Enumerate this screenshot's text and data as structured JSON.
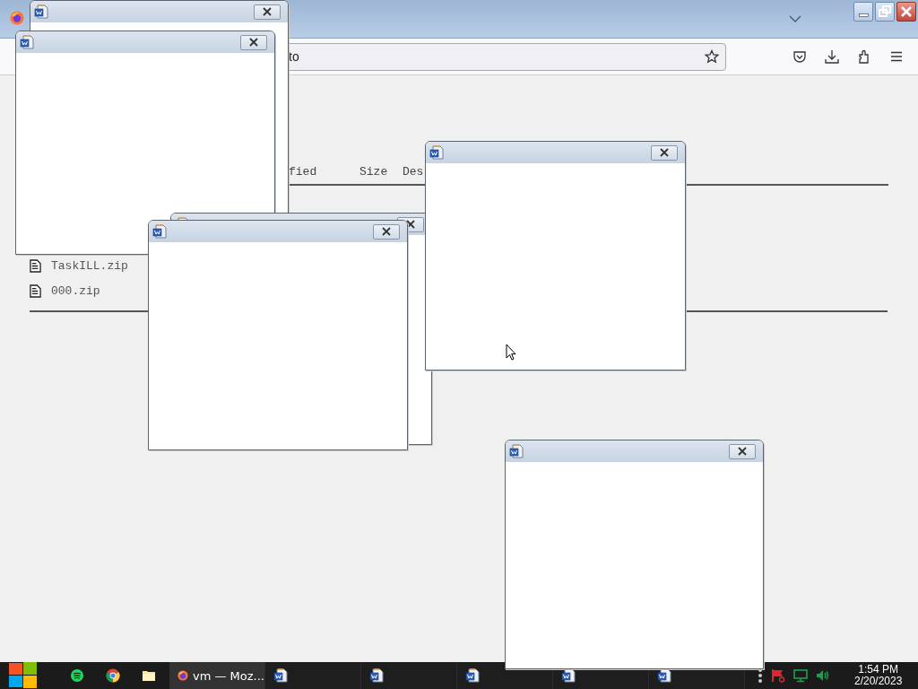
{
  "browser": {
    "address_fragment": "to"
  },
  "listing": {
    "columns": [
      "fied",
      "Size",
      "Des"
    ],
    "files": [
      "TaskILL.zip",
      "000.zip"
    ]
  },
  "taskbar": {
    "windows": [
      {
        "kind": "firefox",
        "label": "vm — Moz...",
        "selected": true
      },
      {
        "kind": "word",
        "selected": false
      },
      {
        "kind": "word",
        "selected": false
      },
      {
        "kind": "word",
        "selected": false
      },
      {
        "kind": "word",
        "selected": false
      },
      {
        "kind": "word",
        "selected": false
      }
    ],
    "clock": {
      "time": "1:54 PM",
      "date": "2/20/2023"
    }
  }
}
